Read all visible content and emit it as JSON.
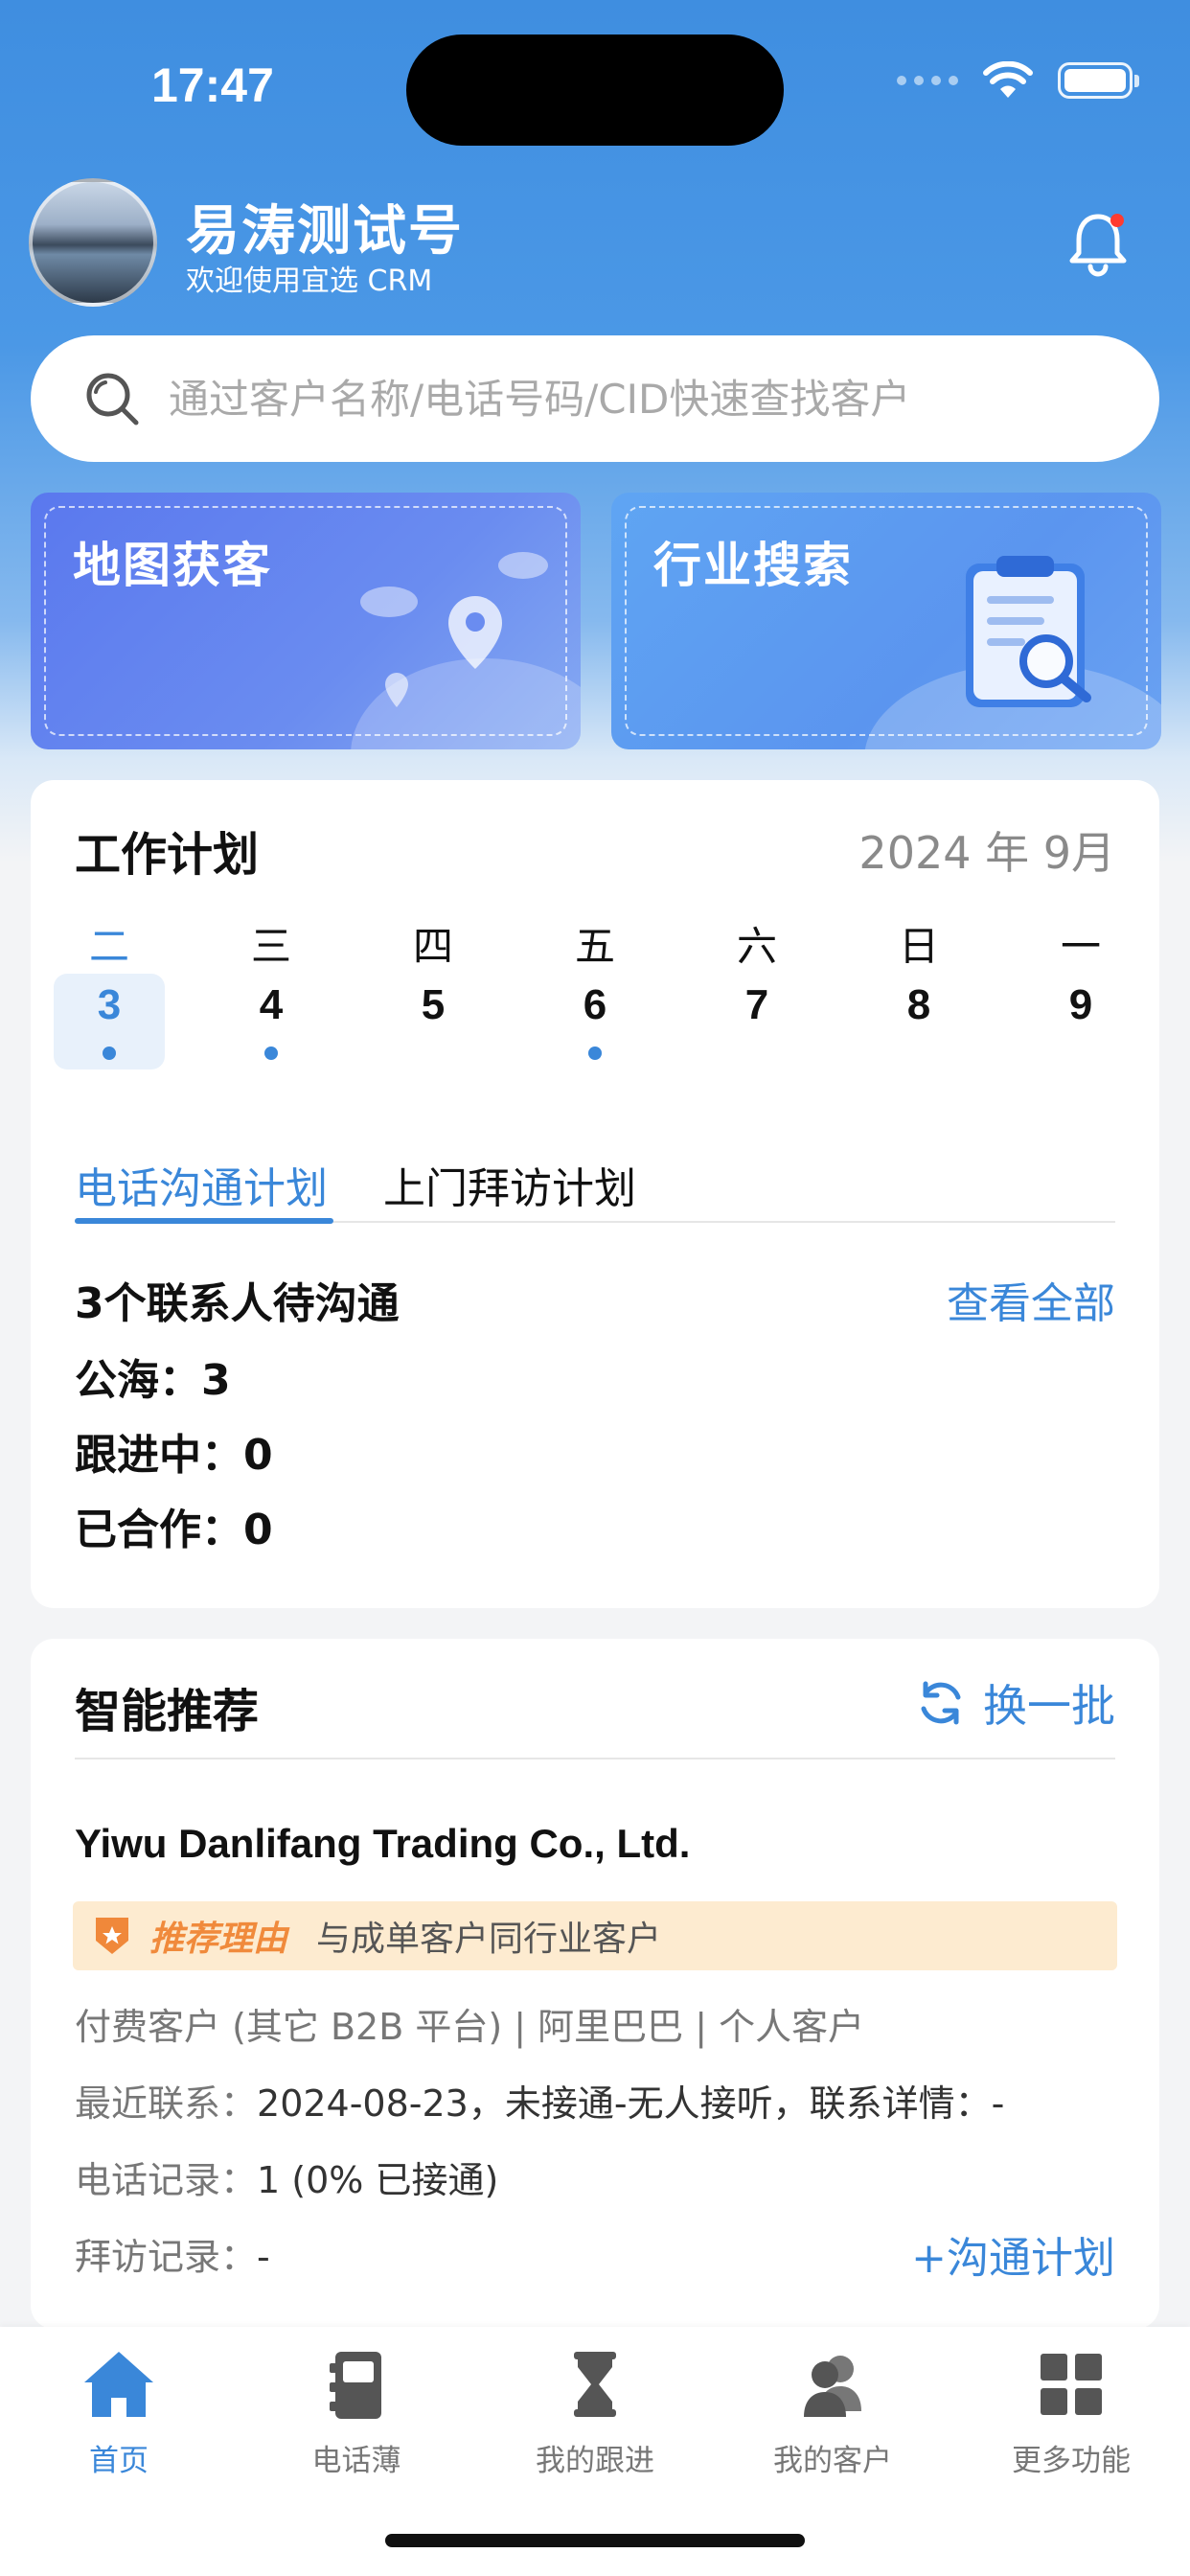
{
  "status_bar": {
    "time": "17:47"
  },
  "header": {
    "name": "易涛测试号",
    "subtitle": "欢迎使用宜选 CRM",
    "notification_icon": "bell-icon"
  },
  "search": {
    "placeholder": "通过客户名称/电话号码/CID快速查找客户"
  },
  "features": [
    {
      "title": "地图获客",
      "icon": "map-pin-icon"
    },
    {
      "title": "行业搜索",
      "icon": "clipboard-search-icon"
    }
  ],
  "work_plan": {
    "title": "工作计划",
    "month": "2024 年 9月",
    "days": [
      {
        "weekday": "二",
        "date": "3"
      },
      {
        "weekday": "三",
        "date": "4"
      },
      {
        "weekday": "四",
        "date": "5"
      },
      {
        "weekday": "五",
        "date": "6"
      },
      {
        "weekday": "六",
        "date": "7"
      },
      {
        "weekday": "日",
        "date": "8"
      },
      {
        "weekday": "一",
        "date": "9"
      }
    ],
    "tabs": [
      "电话沟通计划",
      "上门拜访计划"
    ],
    "summary": "3个联系人待沟通",
    "view_all": "查看全部",
    "stats": [
      {
        "label": "公海：",
        "value": "3"
      },
      {
        "label": "跟进中：",
        "value": "0"
      },
      {
        "label": "已合作：",
        "value": "0"
      }
    ]
  },
  "recommend": {
    "title": "智能推荐",
    "refresh": "换一批",
    "company": "Yiwu Danlifang Trading Co., Ltd.",
    "reason_label": "推荐理由",
    "reason_text": "与成单客户同行业客户",
    "tags": "付费客户 (其它 B2B 平台) | 阿里巴巴 | 个人客户",
    "recent_contact_label": "最近联系：",
    "recent_contact_value": "2024-08-23，未接通-无人接听，联系详情：-",
    "call_record_label": "电话记录：",
    "call_record_value": "1 (0% 已接通)",
    "visit_record_label": "拜访记录：",
    "visit_record_value": "-",
    "add_plan": "+沟通计划"
  },
  "tabbar": [
    {
      "label": "首页",
      "icon": "home-icon"
    },
    {
      "label": "电话薄",
      "icon": "phonebook-icon"
    },
    {
      "label": "我的跟进",
      "icon": "hourglass-icon"
    },
    {
      "label": "我的客户",
      "icon": "customers-icon"
    },
    {
      "label": "更多功能",
      "icon": "grid-icon"
    }
  ],
  "colors": {
    "accent": "#3a87d9",
    "hero": "#3f8ee0",
    "reason_bg": "#fdebd0",
    "reason_text": "#f08a3c"
  }
}
